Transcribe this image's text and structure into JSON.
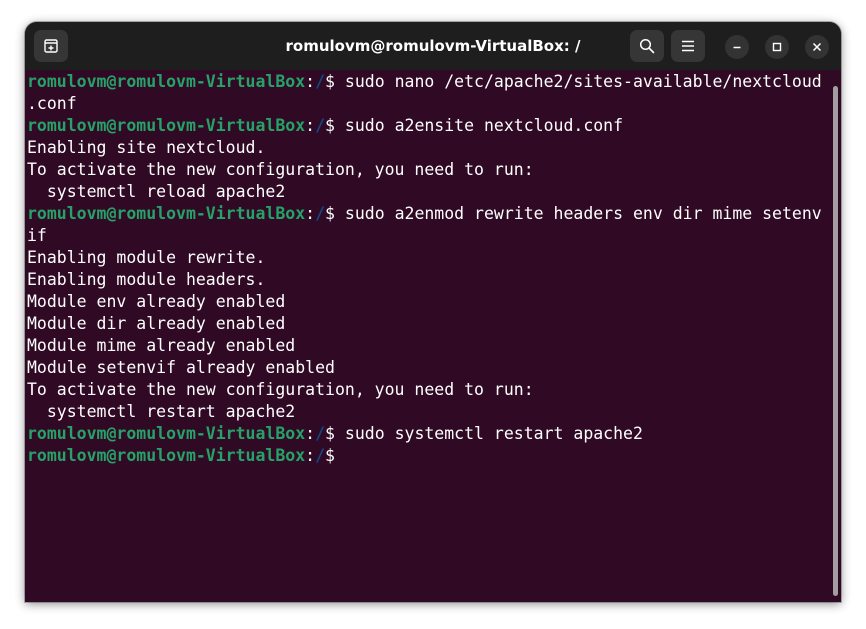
{
  "window": {
    "title": "romulovm@romulovm-VirtualBox: /"
  },
  "icons": {
    "new_tab": "new-tab-icon",
    "search": "search-icon",
    "menu": "hamburger-menu-icon",
    "minimize": "minimize-icon",
    "maximize": "maximize-icon",
    "close": "close-icon"
  },
  "colors": {
    "terminal_bg": "#300a24",
    "titlebar_bg": "#1e1e1e",
    "prompt_user": "#26a269",
    "prompt_path": "#12488b",
    "text": "#ffffff"
  },
  "terminal": {
    "prompt_user": "romulovm@romulovm-VirtualBox",
    "prompt_colon": ":",
    "prompt_path": "/",
    "prompt_symbol": "$ ",
    "lines": [
      {
        "type": "prompt",
        "cmd": "sudo nano /etc/apache2/sites-available/nextcloud"
      },
      {
        "type": "output",
        "text": ".conf"
      },
      {
        "type": "prompt",
        "cmd": "sudo a2ensite nextcloud.conf"
      },
      {
        "type": "output",
        "text": "Enabling site nextcloud."
      },
      {
        "type": "output",
        "text": "To activate the new configuration, you need to run:"
      },
      {
        "type": "output",
        "text": "  systemctl reload apache2"
      },
      {
        "type": "prompt",
        "cmd": "sudo a2enmod rewrite headers env dir mime setenv"
      },
      {
        "type": "output",
        "text": "if"
      },
      {
        "type": "output",
        "text": "Enabling module rewrite."
      },
      {
        "type": "output",
        "text": "Enabling module headers."
      },
      {
        "type": "output",
        "text": "Module env already enabled"
      },
      {
        "type": "output",
        "text": "Module dir already enabled"
      },
      {
        "type": "output",
        "text": "Module mime already enabled"
      },
      {
        "type": "output",
        "text": "Module setenvif already enabled"
      },
      {
        "type": "output",
        "text": "To activate the new configuration, you need to run:"
      },
      {
        "type": "output",
        "text": "  systemctl restart apache2"
      },
      {
        "type": "prompt",
        "cmd": "sudo systemctl restart apache2"
      },
      {
        "type": "prompt",
        "cmd": ""
      }
    ]
  }
}
